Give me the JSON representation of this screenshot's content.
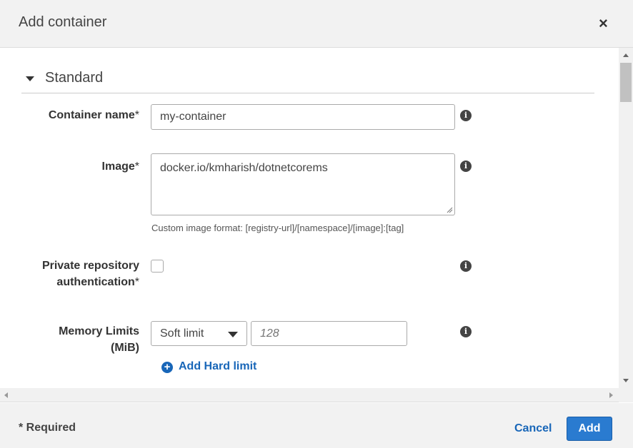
{
  "dialog": {
    "title": "Add container",
    "close_icon": "close-icon"
  },
  "section": {
    "title": "Standard",
    "collapse_icon": "caret-down-icon"
  },
  "fields": {
    "container_name": {
      "label": "Container name",
      "required_mark": "*",
      "value": "my-container"
    },
    "image": {
      "label": "Image",
      "required_mark": "*",
      "value": "docker.io/kmharish/dotnetcorems",
      "hint": "Custom image format: [registry-url]/[namespace]/[image]:[tag]"
    },
    "private_repo": {
      "label_line1": "Private repository",
      "label_line2": "authentication",
      "required_mark": "*",
      "checked": false
    },
    "memory_limits": {
      "label_line1": "Memory Limits",
      "label_line2": "(MiB)",
      "select_value": "Soft limit",
      "input_placeholder": "128",
      "add_hard_limit_label": "Add Hard limit"
    }
  },
  "info_icon_glyph": "i",
  "add_icon_glyph": "+",
  "close_glyph": "×",
  "footer": {
    "required_note": "* Required",
    "cancel_label": "Cancel",
    "add_label": "Add"
  },
  "colors": {
    "link": "#1866b8",
    "primary_button": "#2a7bd0",
    "header_bg": "#f2f2f2"
  }
}
